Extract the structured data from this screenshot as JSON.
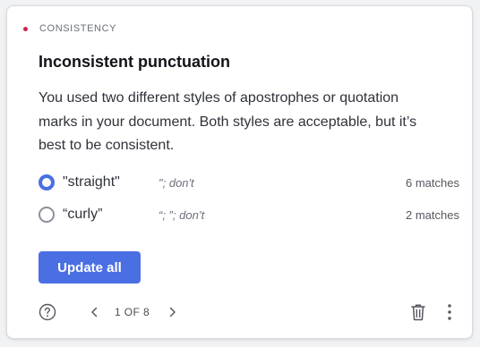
{
  "card": {
    "category": "CONSISTENCY",
    "title": "Inconsistent punctuation",
    "description": "You used two different styles of apostrophes or quotation marks in your document. Both styles are acceptable, but it’s best to be consistent.",
    "options": [
      {
        "label": "\"straight\"",
        "example": "\"; don't",
        "count": "6 matches",
        "selected": true
      },
      {
        "label": "“curly”",
        "example": "“; ”; don’t",
        "count": "2 matches",
        "selected": false
      }
    ],
    "update_button": "Update all",
    "pager": {
      "text": "1 OF 8"
    },
    "colors": {
      "accent": "#4a6fe3",
      "category_dot": "#d1244a"
    },
    "icons": [
      "help-icon",
      "chevron-left-icon",
      "chevron-right-icon",
      "trash-icon",
      "more-vertical-icon"
    ]
  }
}
